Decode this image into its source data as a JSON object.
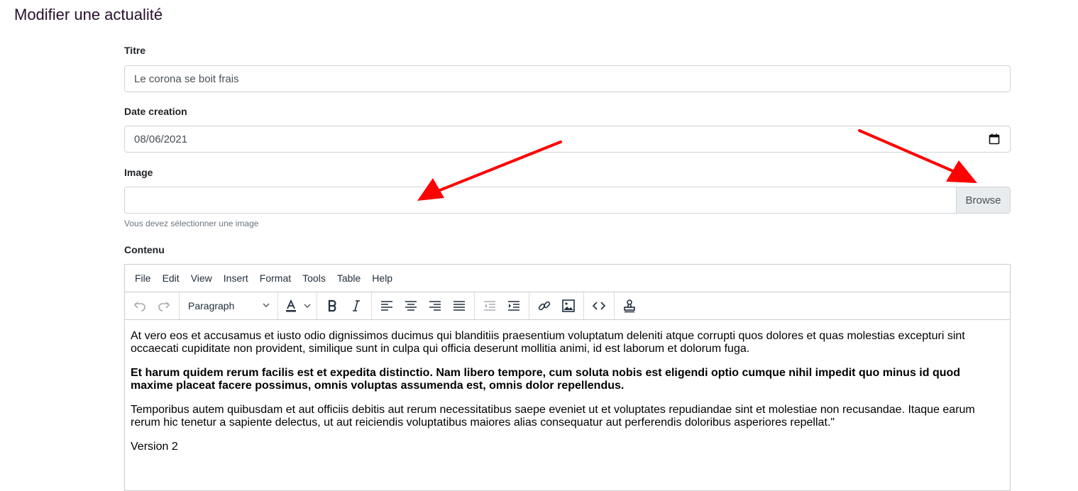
{
  "page": {
    "title": "Modifier une actualité"
  },
  "form": {
    "titre": {
      "label": "Titre",
      "value": "Le corona se boit frais"
    },
    "date_creation": {
      "label": "Date creation",
      "value": "08/06/2021"
    },
    "image": {
      "label": "Image",
      "browse_label": "Browse",
      "help": "Vous devez sélectionner une image"
    },
    "contenu": {
      "label": "Contenu"
    }
  },
  "editor": {
    "menu": [
      "File",
      "Edit",
      "View",
      "Insert",
      "Format",
      "Tools",
      "Table",
      "Help"
    ],
    "block_format": "Paragraph",
    "toolbar_icons": [
      "undo-icon",
      "redo-icon",
      "text-color-icon",
      "bold-icon",
      "italic-icon",
      "align-left-icon",
      "align-center-icon",
      "align-right-icon",
      "align-justify-icon",
      "outdent-icon",
      "indent-icon",
      "link-icon",
      "image-icon",
      "code-icon",
      "stamp-icon"
    ],
    "paragraphs": [
      {
        "text": "At vero eos et accusamus et iusto odio dignissimos ducimus qui blanditiis praesentium voluptatum deleniti atque corrupti quos dolores et quas molestias excepturi sint occaecati cupiditate non provident, similique sunt in culpa qui officia deserunt mollitia animi, id est laborum et dolorum fuga.",
        "bold": false
      },
      {
        "text": "Et harum quidem rerum facilis est et expedita distinctio. Nam libero tempore, cum soluta nobis est eligendi optio cumque nihil impedit quo minus id quod maxime placeat facere possimus, omnis voluptas assumenda est, omnis dolor repellendus.",
        "bold": true
      },
      {
        "text": "Temporibus autem quibusdam et aut officiis debitis aut rerum necessitatibus saepe eveniet ut et voluptates repudiandae sint et molestiae non recusandae. Itaque earum rerum hic tenetur a sapiente delectus, ut aut reiciendis voluptatibus maiores alias consequatur aut perferendis doloribus asperiores repellat.\"",
        "bold": false
      },
      {
        "text": "Version 2",
        "bold": false
      }
    ]
  },
  "colors": {
    "title": "#2a0f2e",
    "arrow": "#ff0000",
    "browse_bg": "#e9ecef",
    "border": "#ced4da"
  }
}
